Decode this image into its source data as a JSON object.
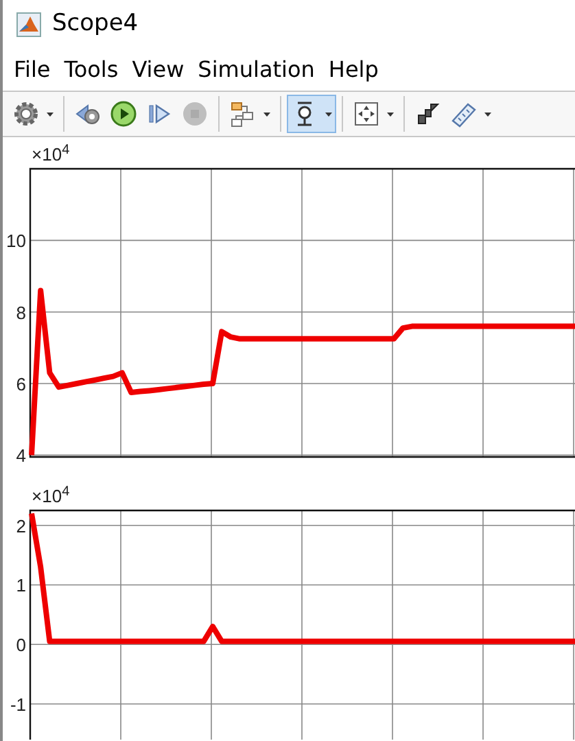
{
  "window": {
    "title": "Scope4"
  },
  "menu": [
    "File",
    "Tools",
    "View",
    "Simulation",
    "Help"
  ],
  "toolbar": [
    {
      "kind": "settings",
      "dropdown": true,
      "selected": false,
      "disabled": false
    },
    {
      "kind": "separator"
    },
    {
      "kind": "step-back",
      "dropdown": false,
      "selected": false,
      "disabled": false
    },
    {
      "kind": "run",
      "dropdown": false,
      "selected": false,
      "disabled": false
    },
    {
      "kind": "step-forward",
      "dropdown": false,
      "selected": false,
      "disabled": false
    },
    {
      "kind": "stop",
      "dropdown": false,
      "selected": false,
      "disabled": true
    },
    {
      "kind": "separator"
    },
    {
      "kind": "signals",
      "dropdown": true,
      "selected": false,
      "disabled": false
    },
    {
      "kind": "separator"
    },
    {
      "kind": "zoom",
      "dropdown": true,
      "selected": true,
      "disabled": false
    },
    {
      "kind": "separator"
    },
    {
      "kind": "fit",
      "dropdown": true,
      "selected": false,
      "disabled": false
    },
    {
      "kind": "separator"
    },
    {
      "kind": "style",
      "dropdown": false,
      "selected": false,
      "disabled": false
    },
    {
      "kind": "measure",
      "dropdown": true,
      "selected": false,
      "disabled": false
    }
  ],
  "plots": [
    {
      "exponent": "×10$^{4}$",
      "chart_data": {
        "type": "line",
        "grid": true,
        "ylim": [
          3.95,
          12
        ],
        "yticks": [
          {
            "value": 10,
            "label": "10"
          },
          {
            "value": 8,
            "label": "8"
          },
          {
            "value": 6,
            "label": "6"
          },
          {
            "value": 4,
            "label": "4"
          }
        ],
        "categories": [
          null,
          null,
          null,
          null,
          null,
          null,
          null,
          null,
          null,
          null,
          null,
          null,
          null,
          null,
          null,
          null,
          null,
          null,
          null,
          null,
          null,
          null,
          null,
          null,
          null,
          null,
          null,
          null,
          null,
          null,
          null,
          null,
          null,
          null,
          null,
          null,
          null,
          null,
          null,
          null,
          null,
          null,
          null,
          null,
          null,
          null,
          null,
          null,
          null,
          null,
          null,
          null,
          null,
          null,
          null,
          null,
          null,
          null,
          null,
          null,
          null
        ],
        "series": [
          {
            "color": "#ee0000",
            "values": [
              4,
              8.6,
              6.3,
              5.9,
              5.95,
              6.0,
              6.05,
              6.1,
              6.15,
              6.2,
              6.3,
              5.75,
              5.78,
              5.8,
              5.83,
              5.86,
              5.89,
              5.92,
              5.95,
              5.98,
              6.0,
              7.45,
              7.3,
              7.25,
              7.25,
              7.25,
              7.25,
              7.25,
              7.25,
              7.25,
              7.25,
              7.25,
              7.25,
              7.25,
              7.25,
              7.25,
              7.25,
              7.25,
              7.25,
              7.25,
              7.25,
              7.55,
              7.6,
              7.6,
              7.6,
              7.6,
              7.6,
              7.6,
              7.6,
              7.6,
              7.6,
              7.6,
              7.6,
              7.6,
              7.6,
              7.6,
              7.6,
              7.6,
              7.6,
              7.6,
              7.6
            ]
          }
        ]
      }
    },
    {
      "exponent": "×10$^{4}$",
      "chart_data": {
        "type": "line",
        "grid": true,
        "ylim": [
          -1.6,
          2.25
        ],
        "yticks": [
          {
            "value": 2,
            "label": "2"
          },
          {
            "value": 1,
            "label": "1"
          },
          {
            "value": 0,
            "label": "0"
          },
          {
            "value": -1,
            "label": "-1"
          }
        ],
        "categories": [
          null,
          null,
          null,
          null,
          null,
          null,
          null,
          null,
          null,
          null,
          null,
          null,
          null,
          null,
          null,
          null,
          null,
          null,
          null,
          null,
          null,
          null,
          null,
          null,
          null,
          null,
          null,
          null,
          null,
          null,
          null,
          null,
          null,
          null,
          null,
          null,
          null,
          null,
          null,
          null,
          null,
          null,
          null,
          null,
          null,
          null,
          null,
          null,
          null,
          null,
          null,
          null,
          null,
          null,
          null,
          null,
          null,
          null,
          null,
          null,
          null
        ],
        "series": [
          {
            "color": "#ee0000",
            "values": [
              2.2,
              1.3,
              0.05,
              0.05,
              0.05,
              0.05,
              0.05,
              0.05,
              0.05,
              0.05,
              0.05,
              0.05,
              0.05,
              0.05,
              0.05,
              0.05,
              0.05,
              0.05,
              0.05,
              0.05,
              0.3,
              0.05,
              0.05,
              0.05,
              0.05,
              0.05,
              0.05,
              0.05,
              0.05,
              0.05,
              0.05,
              0.05,
              0.05,
              0.05,
              0.05,
              0.05,
              0.05,
              0.05,
              0.05,
              0.05,
              0.05,
              0.05,
              0.05,
              0.05,
              0.05,
              0.05,
              0.05,
              0.05,
              0.05,
              0.05,
              0.05,
              0.05,
              0.05,
              0.05,
              0.05,
              0.05,
              0.05,
              0.05,
              0.05,
              0.05,
              0.05
            ]
          }
        ]
      }
    }
  ]
}
